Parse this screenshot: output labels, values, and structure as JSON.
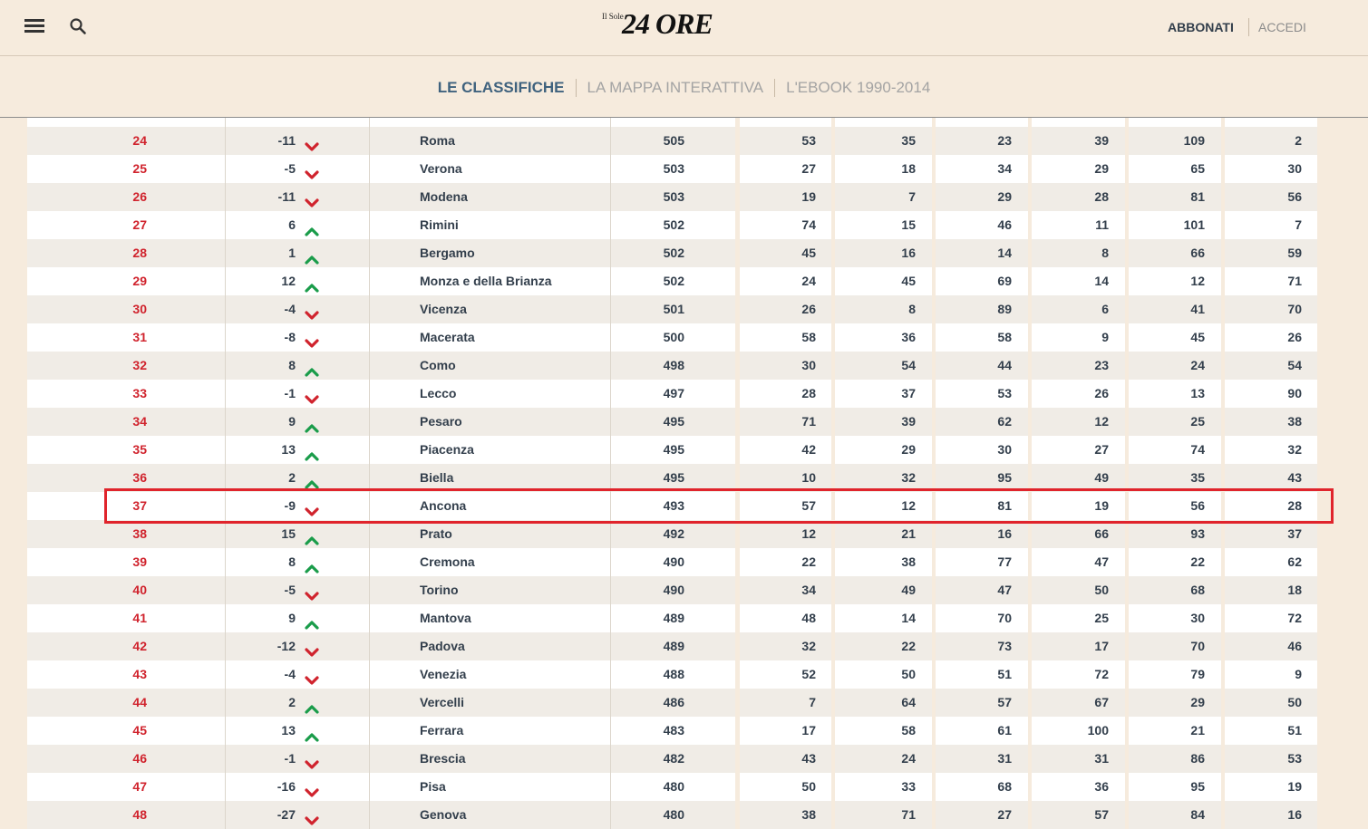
{
  "header": {
    "logo_small": "Il Sole",
    "logo_big": "24 ORE",
    "subscribe_label": "ABBONATI",
    "login_label": "ACCEDI",
    "icons": [
      "menu-icon",
      "search-icon"
    ]
  },
  "subnav": {
    "tabs": [
      {
        "label": "LE CLASSIFICHE",
        "active": true
      },
      {
        "label": "LA MAPPA INTERATTIVA",
        "active": false
      },
      {
        "label": "L'EBOOK 1990-2014",
        "active": false
      }
    ]
  },
  "colors": {
    "rank_red": "#d0232d",
    "up_green": "#1a9c4a",
    "down_red": "#d0232d",
    "highlight_border": "#e0242c",
    "text": "#333f4c",
    "background": "#f6ebdd"
  },
  "table": {
    "highlighted_city": "Ancona",
    "rows": [
      {
        "rank": "24",
        "delta": "-11",
        "trend": "down",
        "city": "Roma",
        "score": "505",
        "c1": "53",
        "c2": "35",
        "c3": "23",
        "c4": "39",
        "c5": "109",
        "c6": "2"
      },
      {
        "rank": "25",
        "delta": "-5",
        "trend": "down",
        "city": "Verona",
        "score": "503",
        "c1": "27",
        "c2": "18",
        "c3": "34",
        "c4": "29",
        "c5": "65",
        "c6": "30"
      },
      {
        "rank": "26",
        "delta": "-11",
        "trend": "down",
        "city": "Modena",
        "score": "503",
        "c1": "19",
        "c2": "7",
        "c3": "29",
        "c4": "28",
        "c5": "81",
        "c6": "56"
      },
      {
        "rank": "27",
        "delta": "6",
        "trend": "up",
        "city": "Rimini",
        "score": "502",
        "c1": "74",
        "c2": "15",
        "c3": "46",
        "c4": "11",
        "c5": "101",
        "c6": "7"
      },
      {
        "rank": "28",
        "delta": "1",
        "trend": "up",
        "city": "Bergamo",
        "score": "502",
        "c1": "45",
        "c2": "16",
        "c3": "14",
        "c4": "8",
        "c5": "66",
        "c6": "59"
      },
      {
        "rank": "29",
        "delta": "12",
        "trend": "up",
        "city": "Monza e della Brianza",
        "score": "502",
        "c1": "24",
        "c2": "45",
        "c3": "69",
        "c4": "14",
        "c5": "12",
        "c6": "71"
      },
      {
        "rank": "30",
        "delta": "-4",
        "trend": "down",
        "city": "Vicenza",
        "score": "501",
        "c1": "26",
        "c2": "8",
        "c3": "89",
        "c4": "6",
        "c5": "41",
        "c6": "70"
      },
      {
        "rank": "31",
        "delta": "-8",
        "trend": "down",
        "city": "Macerata",
        "score": "500",
        "c1": "58",
        "c2": "36",
        "c3": "58",
        "c4": "9",
        "c5": "45",
        "c6": "26"
      },
      {
        "rank": "32",
        "delta": "8",
        "trend": "up",
        "city": "Como",
        "score": "498",
        "c1": "30",
        "c2": "54",
        "c3": "44",
        "c4": "23",
        "c5": "24",
        "c6": "54"
      },
      {
        "rank": "33",
        "delta": "-1",
        "trend": "down",
        "city": "Lecco",
        "score": "497",
        "c1": "28",
        "c2": "37",
        "c3": "53",
        "c4": "26",
        "c5": "13",
        "c6": "90"
      },
      {
        "rank": "34",
        "delta": "9",
        "trend": "up",
        "city": "Pesaro",
        "score": "495",
        "c1": "71",
        "c2": "39",
        "c3": "62",
        "c4": "12",
        "c5": "25",
        "c6": "38"
      },
      {
        "rank": "35",
        "delta": "13",
        "trend": "up",
        "city": "Piacenza",
        "score": "495",
        "c1": "42",
        "c2": "29",
        "c3": "30",
        "c4": "27",
        "c5": "74",
        "c6": "32"
      },
      {
        "rank": "36",
        "delta": "2",
        "trend": "up",
        "city": "Biella",
        "score": "495",
        "c1": "10",
        "c2": "32",
        "c3": "95",
        "c4": "49",
        "c5": "35",
        "c6": "43"
      },
      {
        "rank": "37",
        "delta": "-9",
        "trend": "down",
        "city": "Ancona",
        "score": "493",
        "c1": "57",
        "c2": "12",
        "c3": "81",
        "c4": "19",
        "c5": "56",
        "c6": "28"
      },
      {
        "rank": "38",
        "delta": "15",
        "trend": "up",
        "city": "Prato",
        "score": "492",
        "c1": "12",
        "c2": "21",
        "c3": "16",
        "c4": "66",
        "c5": "93",
        "c6": "37"
      },
      {
        "rank": "39",
        "delta": "8",
        "trend": "up",
        "city": "Cremona",
        "score": "490",
        "c1": "22",
        "c2": "38",
        "c3": "77",
        "c4": "47",
        "c5": "22",
        "c6": "62"
      },
      {
        "rank": "40",
        "delta": "-5",
        "trend": "down",
        "city": "Torino",
        "score": "490",
        "c1": "34",
        "c2": "49",
        "c3": "47",
        "c4": "50",
        "c5": "68",
        "c6": "18"
      },
      {
        "rank": "41",
        "delta": "9",
        "trend": "up",
        "city": "Mantova",
        "score": "489",
        "c1": "48",
        "c2": "14",
        "c3": "70",
        "c4": "25",
        "c5": "30",
        "c6": "72"
      },
      {
        "rank": "42",
        "delta": "-12",
        "trend": "down",
        "city": "Padova",
        "score": "489",
        "c1": "32",
        "c2": "22",
        "c3": "73",
        "c4": "17",
        "c5": "70",
        "c6": "46"
      },
      {
        "rank": "43",
        "delta": "-4",
        "trend": "down",
        "city": "Venezia",
        "score": "488",
        "c1": "52",
        "c2": "50",
        "c3": "51",
        "c4": "72",
        "c5": "79",
        "c6": "9"
      },
      {
        "rank": "44",
        "delta": "2",
        "trend": "up",
        "city": "Vercelli",
        "score": "486",
        "c1": "7",
        "c2": "64",
        "c3": "57",
        "c4": "67",
        "c5": "29",
        "c6": "50"
      },
      {
        "rank": "45",
        "delta": "13",
        "trend": "up",
        "city": "Ferrara",
        "score": "483",
        "c1": "17",
        "c2": "58",
        "c3": "61",
        "c4": "100",
        "c5": "21",
        "c6": "51"
      },
      {
        "rank": "46",
        "delta": "-1",
        "trend": "down",
        "city": "Brescia",
        "score": "482",
        "c1": "43",
        "c2": "24",
        "c3": "31",
        "c4": "31",
        "c5": "86",
        "c6": "53"
      },
      {
        "rank": "47",
        "delta": "-16",
        "trend": "down",
        "city": "Pisa",
        "score": "480",
        "c1": "50",
        "c2": "33",
        "c3": "68",
        "c4": "36",
        "c5": "95",
        "c6": "19"
      },
      {
        "rank": "48",
        "delta": "-27",
        "trend": "down",
        "city": "Genova",
        "score": "480",
        "c1": "38",
        "c2": "71",
        "c3": "27",
        "c4": "57",
        "c5": "84",
        "c6": "16"
      }
    ]
  }
}
